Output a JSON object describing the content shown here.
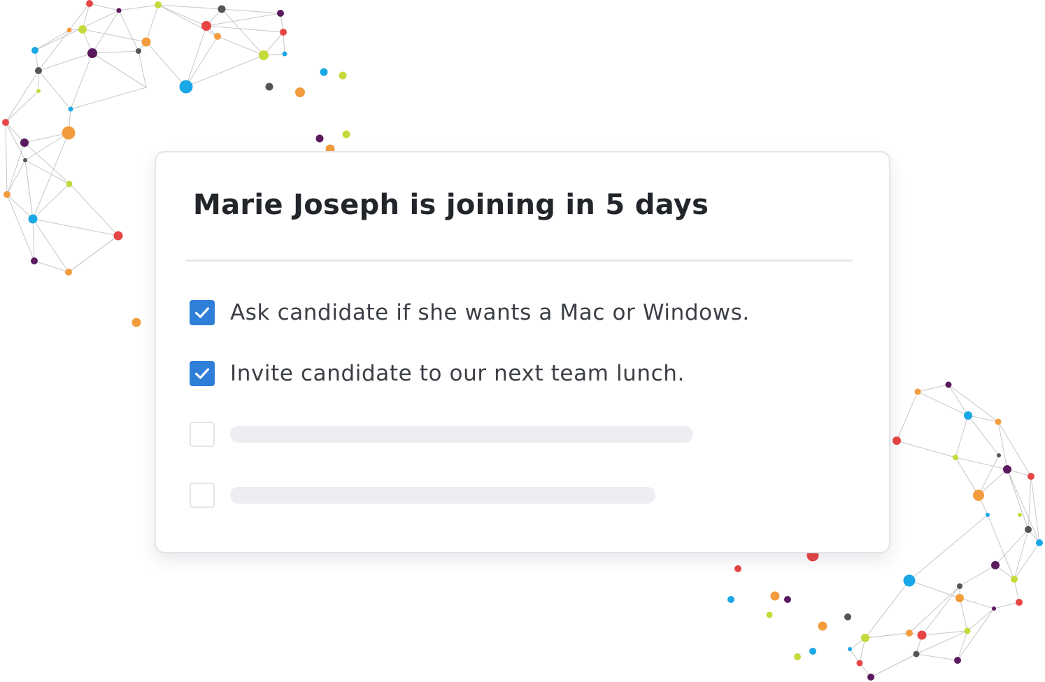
{
  "card": {
    "title": "Marie Joseph is joining in 5 days",
    "tasks": [
      {
        "label": "Ask candidate if she wants a Mac or Windows.",
        "checked": true
      },
      {
        "label": "Invite candidate to our next team lunch.",
        "checked": true
      },
      {
        "label": "",
        "checked": false,
        "placeholder": true
      },
      {
        "label": "",
        "checked": false,
        "placeholder": true
      }
    ]
  },
  "icons": {
    "checkbox_checked": "checkmark-icon"
  },
  "colors": {
    "accent": "#2f7ed8",
    "placeholder": "#eceef1",
    "dot_palette": [
      "#e84545",
      "#f39c3d",
      "#c6d93a",
      "#1aa7e8",
      "#5a1a5e",
      "#555555"
    ]
  }
}
